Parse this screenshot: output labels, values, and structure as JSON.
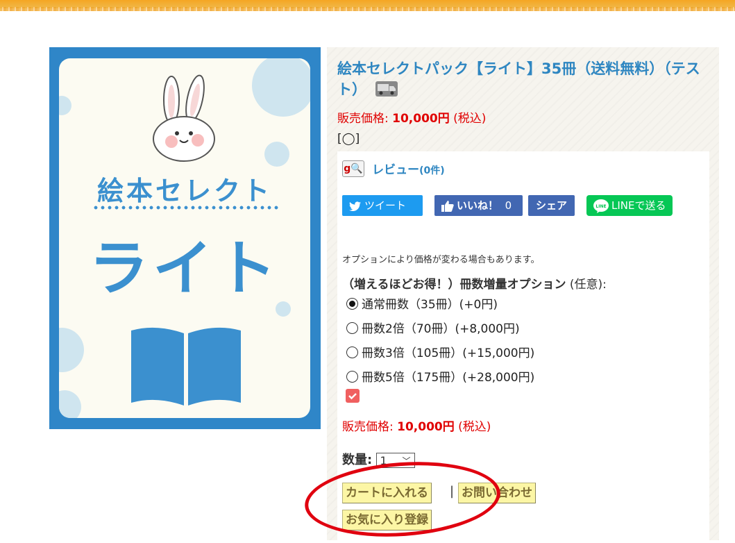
{
  "product": {
    "image": {
      "card_title": "絵本セレクト",
      "card_big": "ライト"
    },
    "title": "絵本セレクトパック【ライト】35冊（送料無料）（テスト）",
    "price_label": "販売価格: ",
    "price_value": "10,000円",
    "price_tax": " (税込)",
    "bracket": "[◯]"
  },
  "review": {
    "label": "レビュー",
    "count": "(0件)"
  },
  "sns": {
    "tweet": "ツイート",
    "like": "いいね！",
    "like_count": "0",
    "share": "シェア",
    "line": "LINEで送る"
  },
  "options": {
    "note": "オプションにより価格が変わる場合もあります。",
    "title": "（増えるほどお得！）冊数増量オプション",
    "optional": " (任意):",
    "choices": [
      {
        "label": "通常冊数（35冊）(+0円)",
        "selected": true
      },
      {
        "label": "冊数2倍（70冊）(+8,000円)",
        "selected": false
      },
      {
        "label": "冊数3倍（105冊）(+15,000円)",
        "selected": false
      },
      {
        "label": "冊数5倍（175冊）(+28,000円)",
        "selected": false
      }
    ]
  },
  "price2": {
    "label": "販売価格: ",
    "value": "10,000円",
    "tax": " (税込)"
  },
  "quantity": {
    "label": "数量:",
    "value": "1"
  },
  "buttons": {
    "cart": "カートに入れる",
    "separator": "|",
    "inquiry": "お問い合わせ",
    "favorite": "お気に入り登録"
  },
  "colors": {
    "link": "#2e86c1",
    "price": "#e00000",
    "button_bg": "#fcf6a5",
    "annotation": "#e0000f"
  }
}
